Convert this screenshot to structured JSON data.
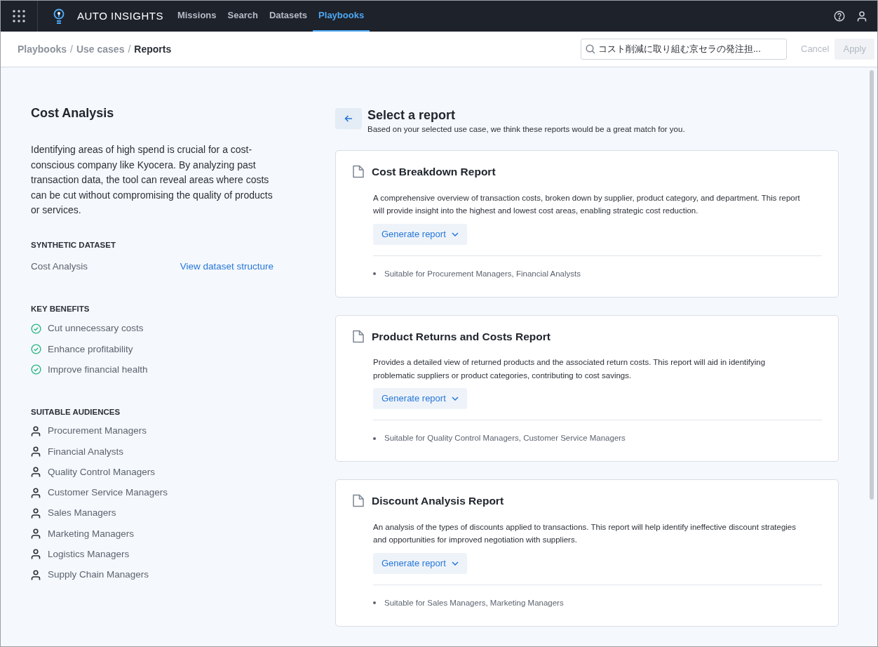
{
  "nav": {
    "brand": "AUTO INSIGHTS",
    "items": [
      {
        "label": "Missions",
        "selected": false
      },
      {
        "label": "Search",
        "selected": false
      },
      {
        "label": "Datasets",
        "selected": false
      },
      {
        "label": "Playbooks",
        "selected": true
      }
    ]
  },
  "breadcrumb": [
    {
      "label": "Playbooks",
      "current": false
    },
    {
      "label": "/",
      "kind": "sep"
    },
    {
      "label": "Use cases",
      "current": false
    },
    {
      "label": "/",
      "kind": "sep"
    },
    {
      "label": "Reports",
      "current": true
    }
  ],
  "search": {
    "value": "コスト削減に取り組む京セラの発注担..."
  },
  "actions": [
    {
      "label": "Cancel",
      "kind": "link",
      "disabled": true
    },
    {
      "label": "Apply",
      "kind": "button",
      "disabled": true
    }
  ],
  "use_case": {
    "title": "Cost Analysis",
    "description": "Identifying areas of high spend is crucial for a cost-conscious company like Kyocera. By analyzing past transaction data, the tool can reveal areas where costs can be cut without compromising the quality of products or services.",
    "dataset_heading": "SYNTHETIC DATASET",
    "dataset_name": "Cost Analysis",
    "dataset_link": "View dataset structure",
    "benefits_heading": "KEY BENEFITS",
    "benefits": [
      "Cut unnecessary costs",
      "Enhance profitability",
      "Improve financial health"
    ],
    "audiences_heading": "SUITABLE AUDIENCES",
    "audiences": [
      "Procurement Managers",
      "Financial Analysts",
      "Quality Control Managers",
      "Customer Service Managers",
      "Sales Managers",
      "Marketing Managers",
      "Logistics Managers",
      "Supply Chain Managers"
    ]
  },
  "reports_header": {
    "title": "Select a report",
    "subtitle": "Based on your selected use case, we think these reports would be a great match for you."
  },
  "reports": [
    {
      "title": "Cost Breakdown Report",
      "description": "A comprehensive overview of transaction costs, broken down by supplier, product category, and department. This report will provide insight into the highest and lowest cost areas, enabling strategic cost reduction.",
      "button": "Generate report",
      "audience": "Suitable for Procurement Managers, Financial Analysts"
    },
    {
      "title": "Product Returns and Costs Report",
      "description": "Provides a detailed view of returned products and the associated return costs. This report will aid in identifying problematic suppliers or product categories, contributing to cost savings.",
      "button": "Generate report",
      "audience": "Suitable for Quality Control Managers, Customer Service Managers"
    },
    {
      "title": "Discount Analysis Report",
      "description": "An analysis of the types of discounts applied to transactions. This report will help identify ineffective discount strategies and opportunities for improved negotiation with suppliers.",
      "button": "Generate report",
      "audience": "Suitable for Sales Managers, Marketing Managers"
    }
  ]
}
